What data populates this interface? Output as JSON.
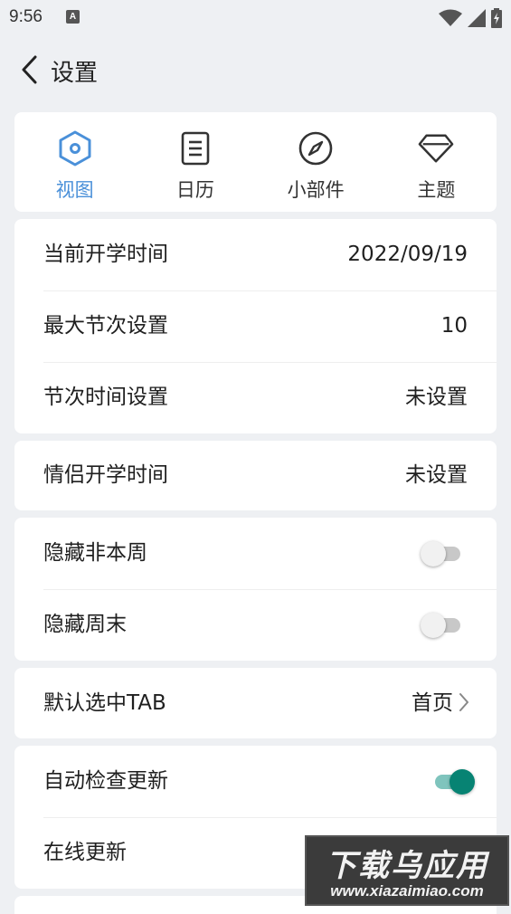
{
  "status_bar": {
    "time": "9:56",
    "notif_glyph": "A"
  },
  "header": {
    "title": "设置"
  },
  "tabs": [
    {
      "label": "视图",
      "icon": "hexagon-icon",
      "active": true
    },
    {
      "label": "日历",
      "icon": "document-icon",
      "active": false
    },
    {
      "label": "小部件",
      "icon": "compass-icon",
      "active": false
    },
    {
      "label": "主题",
      "icon": "diamond-icon",
      "active": false
    }
  ],
  "group1": {
    "start_date": {
      "label": "当前开学时间",
      "value": "2022/09/19"
    },
    "max_sessions": {
      "label": "最大节次设置",
      "value": "10"
    },
    "session_time": {
      "label": "节次时间设置",
      "value": "未设置"
    }
  },
  "group2": {
    "couple_start": {
      "label": "情侣开学时间",
      "value": "未设置"
    }
  },
  "group3": {
    "hide_other_weeks": {
      "label": "隐藏非本周",
      "enabled": false
    },
    "hide_weekend": {
      "label": "隐藏周末",
      "enabled": false
    }
  },
  "group4": {
    "default_tab": {
      "label": "默认选中TAB",
      "value": "首页"
    }
  },
  "group5": {
    "auto_update": {
      "label": "自动检查更新",
      "enabled": true
    },
    "online_update": {
      "label": "在线更新"
    }
  },
  "watermark": {
    "title": "下载乌应用",
    "url": "www.xiazaimiao.com"
  },
  "colors": {
    "accent": "#4a90d9",
    "toggle_on": "#078373",
    "background": "#eef0f3"
  }
}
